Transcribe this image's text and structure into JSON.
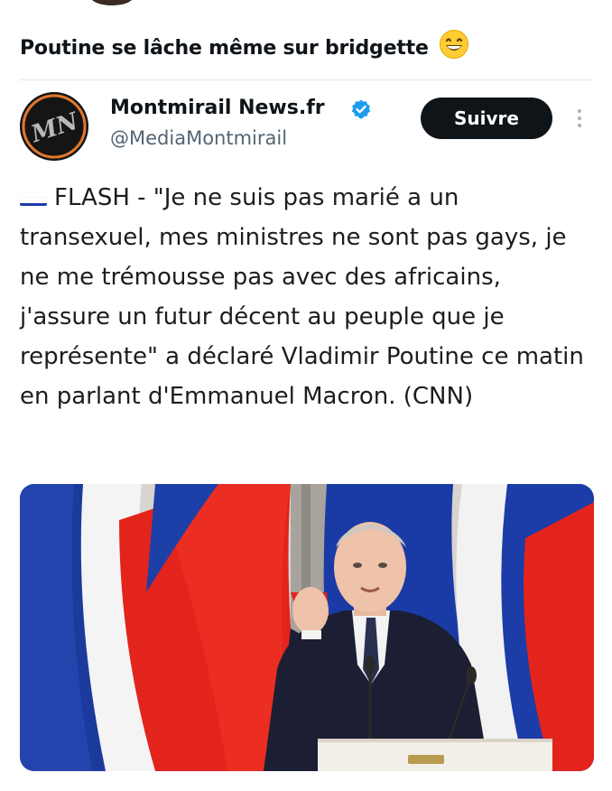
{
  "post": {
    "caption": "Poutine se lâche même sur bridgette",
    "caption_emoji": "grinning-face-emoji"
  },
  "tweet": {
    "display_name": "Montmirail News.fr",
    "handle": "@MediaMontmirail",
    "avatar_text": "MN",
    "verified": true,
    "follow_label": "Suivre",
    "flag_icon": "russia-flag-icon",
    "text": "FLASH - \"Je ne suis pas marié a un transexuel, mes ministres ne sont pas gays, je ne me trémousse pas avec des africains, j'assure un futur décent au peuple que je représente\" a déclaré Vladimir Poutine ce matin en parlant d'Emmanuel Macron. (CNN)"
  },
  "photo": {
    "subject": "speaker-at-podium-with-flags"
  },
  "colors": {
    "follow_bg": "#0f1419",
    "verified_blue": "#1d9bf0",
    "handle_gray": "#536471",
    "flag_white": "#ffffff",
    "flag_blue": "#1c3aa9",
    "flag_red": "#e4181c"
  }
}
